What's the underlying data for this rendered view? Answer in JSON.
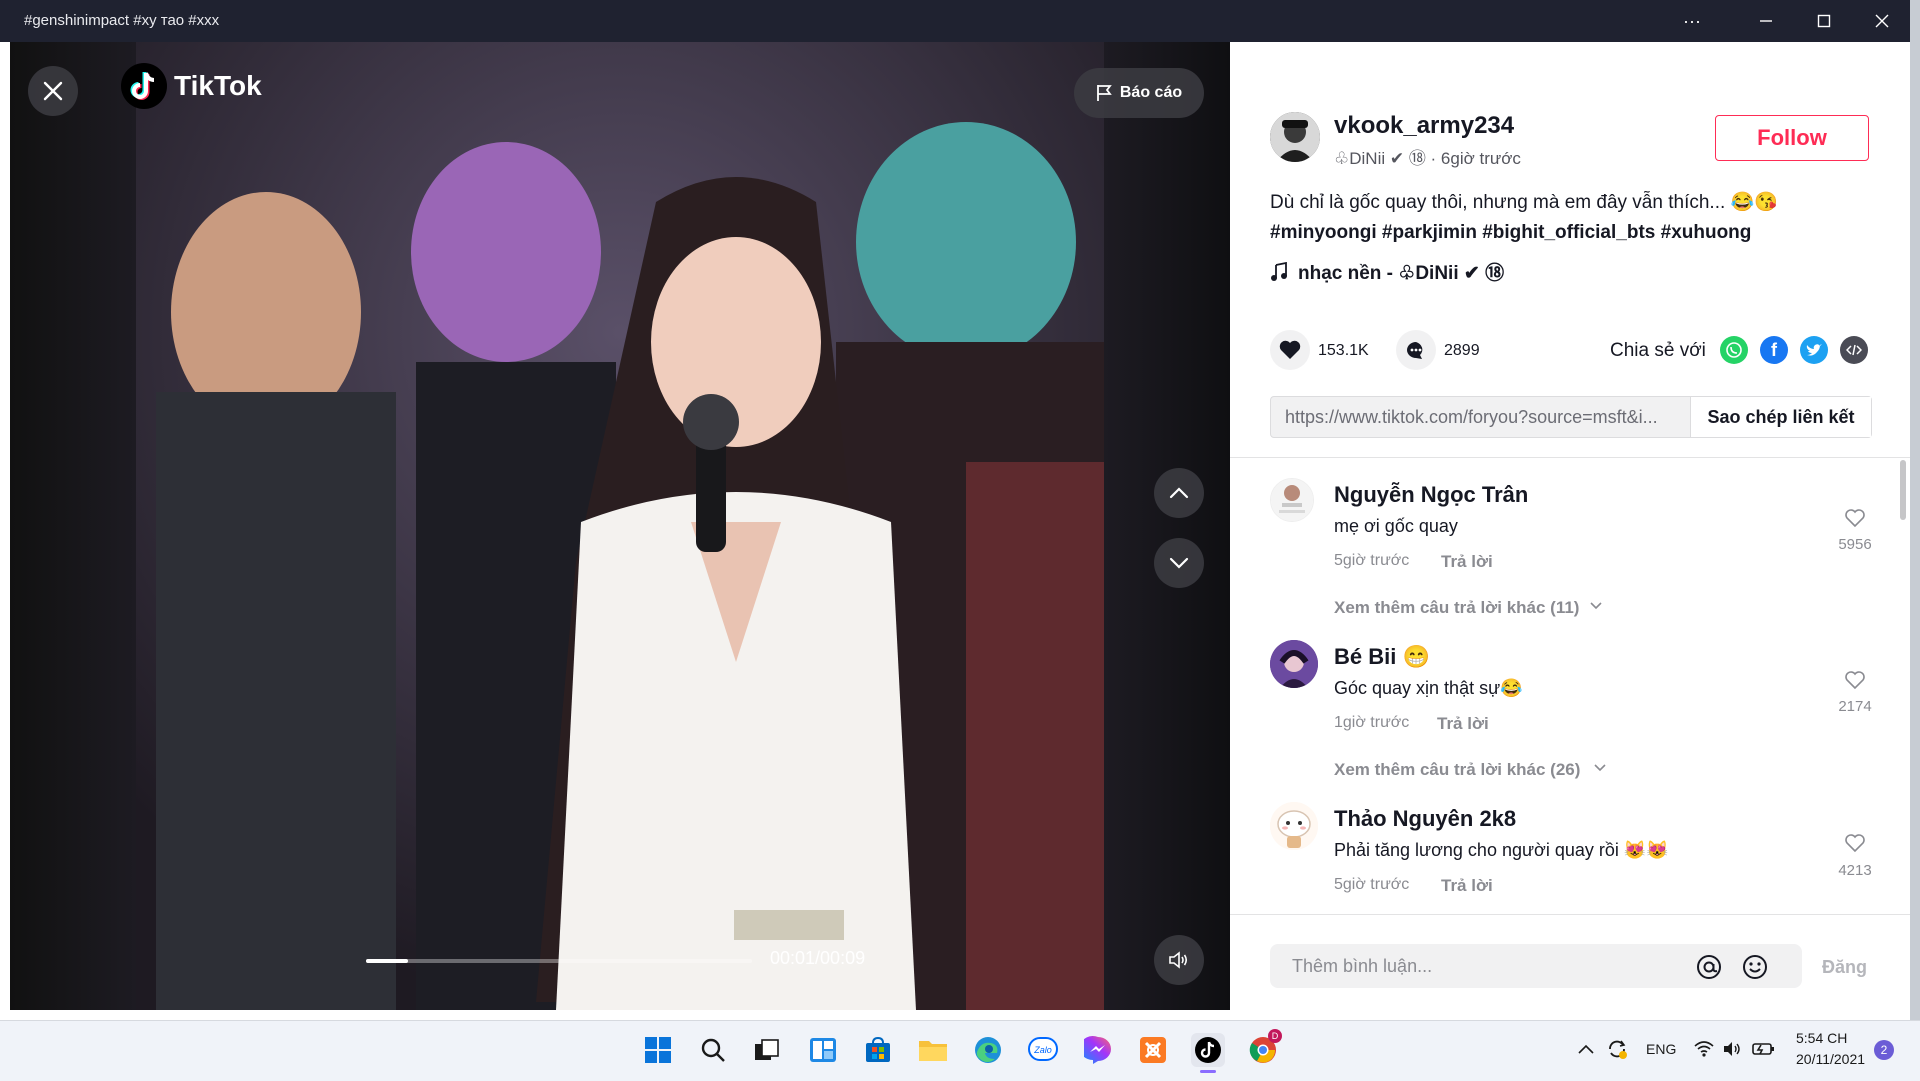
{
  "window": {
    "title": "#genshinimpact #xy тао #xxx",
    "more_label": "···"
  },
  "video": {
    "logo_text": "TikTok",
    "report_label": "Báo cáo",
    "time": "00:01/00:09",
    "progress": 0.11
  },
  "author": {
    "username": "vkook_army234",
    "meta": "♧DiNii ✔ ⑱ · 6giờ trước",
    "follow_label": "Follow"
  },
  "post": {
    "caption": "Dù chỉ là gốc quay thôi, nhưng mà em đây vẫn thích... 😂😘",
    "hashtags": "#minyoongi #parkjimin #bighit_official_bts #xuhuong",
    "music": "nhạc nền - ♧DiNii ✔ ⑱",
    "likes": "153.1K",
    "comments_count": "2899",
    "share_label": "Chia sẻ với",
    "link": "https://www.tiktok.com/foryou?source=msft&i...",
    "copy_label": "Sao chép liên kết"
  },
  "comments": [
    {
      "name": "Nguyễn Ngọc Trân",
      "text": "mẹ ơi gốc quay",
      "time": "5giờ trước",
      "reply": "Trả lời",
      "likes": "5956",
      "more": "Xem thêm câu trả lời khác (11)"
    },
    {
      "name": "Bé Bii 😁",
      "text": "Góc quay xịn thật sự😂",
      "time": "1giờ trước",
      "reply": "Trả lời",
      "likes": "2174",
      "more": "Xem thêm câu trả lời khác (26)"
    },
    {
      "name": "Thảo Nguyên 2k8",
      "text": "Phải tăng lương cho người quay rồi 😻😻",
      "time": "5giờ trước",
      "reply": "Trả lời",
      "likes": "4213"
    }
  ],
  "comment_box": {
    "placeholder": "Thêm bình luận...",
    "post_label": "Đăng"
  },
  "taskbar": {
    "lang": "ENG",
    "time": "5:54 CH",
    "date": "20/11/2021",
    "notification_count": "2",
    "chrome_badge": "D"
  },
  "colors": {
    "accent": "#fe2c55",
    "whatsapp": "#25d366",
    "facebook": "#1877f2",
    "twitter": "#1da1f2",
    "embed": "#4a4b55"
  }
}
